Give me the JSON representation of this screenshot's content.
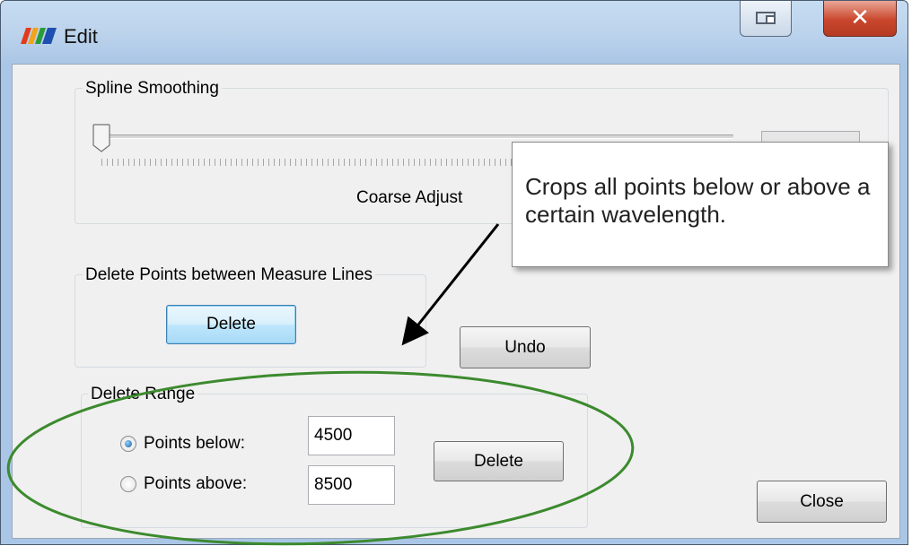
{
  "window": {
    "title": "Edit"
  },
  "spline": {
    "group_label": "Spline Smoothing",
    "caption": "Coarse Adjust"
  },
  "delete_between": {
    "group_label": "Delete Points between Measure Lines",
    "delete_label": "Delete"
  },
  "undo_label": "Undo",
  "delete_range": {
    "group_label": "Delete Range",
    "below_label": "Points below:",
    "below_value": "4500",
    "below_selected": true,
    "above_label": "Points above:",
    "above_value": "8500",
    "above_selected": false,
    "delete_label": "Delete"
  },
  "close_label": "Close",
  "callout": {
    "text": "Crops all points below or above a certain wavelength."
  },
  "colors": {
    "annotation_ellipse": "#3c8a2e",
    "arrow": "#000000",
    "titlebar_close": "#c9462c"
  }
}
